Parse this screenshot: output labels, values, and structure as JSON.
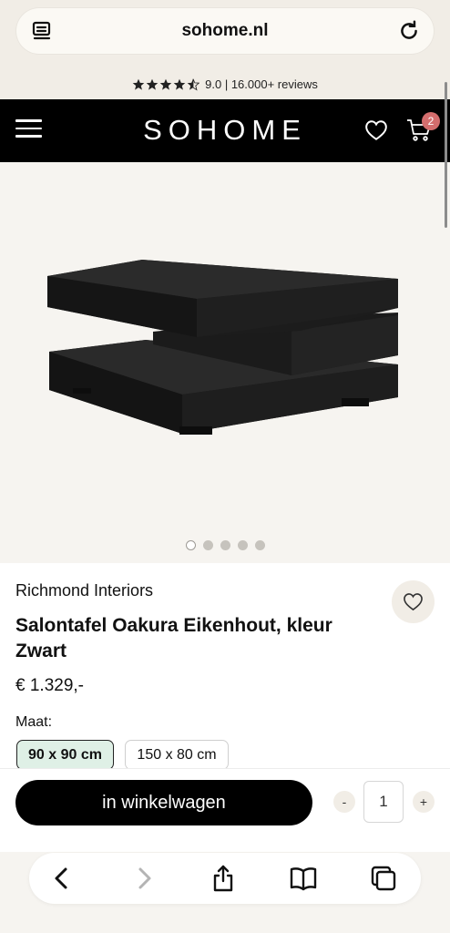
{
  "browser": {
    "url": "sohome.nl"
  },
  "reviews": {
    "rating_text": "9.0 | 16.000+ reviews",
    "stars": 4.5
  },
  "header": {
    "logo": "SOHOME",
    "cart_count": "2"
  },
  "gallery": {
    "image_count": 5,
    "active_index": 0
  },
  "product": {
    "brand": "Richmond Interiors",
    "title": "Salontafel Oakura Eikenhout, kleur Zwart",
    "price": "€ 1.329,-",
    "size_label": "Maat:",
    "sizes": [
      "90 x 90 cm",
      "150 x 80 cm"
    ],
    "selected_size": "90 x 90 cm"
  },
  "purchase": {
    "add_to_cart_label": "in winkelwagen",
    "quantity": "1",
    "minus_label": "-",
    "plus_label": "+"
  },
  "colors": {
    "header_bg": "#000000",
    "chrome_bg": "#f1ede6",
    "selected_size_bg": "#dff0e6",
    "badge": "#d46d6d"
  }
}
